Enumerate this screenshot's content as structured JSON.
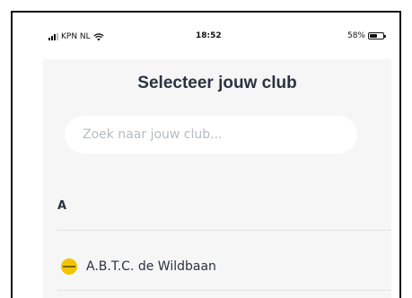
{
  "status_bar": {
    "carrier": "KPN NL",
    "time": "18:52",
    "battery": "58%",
    "battery_level": 0.58
  },
  "page": {
    "title": "Selecteer jouw club"
  },
  "search": {
    "placeholder": "Zoek naar jouw club...",
    "value": ""
  },
  "sections": [
    {
      "letter": "A",
      "clubs": [
        {
          "name": "A.B.T.C. de Wildbaan",
          "logo_color": "#f3c400"
        }
      ]
    }
  ]
}
